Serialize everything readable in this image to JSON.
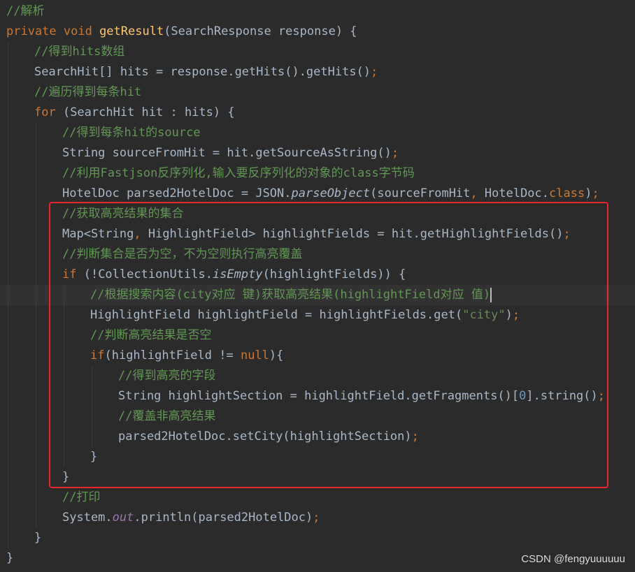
{
  "editor": {
    "lines": [
      {
        "indent": 0,
        "current": false,
        "tokens": [
          {
            "t": "//解析",
            "c": "cm"
          }
        ]
      },
      {
        "indent": 0,
        "current": false,
        "tokens": [
          {
            "t": "private void ",
            "c": "kw"
          },
          {
            "t": "getResult",
            "c": "fn"
          },
          {
            "t": "(SearchResponse response) {",
            "c": ""
          }
        ]
      },
      {
        "indent": 1,
        "current": false,
        "tokens": [
          {
            "t": "//得到hits数组",
            "c": "cm"
          }
        ]
      },
      {
        "indent": 1,
        "current": false,
        "tokens": [
          {
            "t": "SearchHit[] hits = response.getHits().getHits()",
            "c": ""
          },
          {
            "t": ";",
            "c": "kw"
          }
        ]
      },
      {
        "indent": 1,
        "current": false,
        "tokens": [
          {
            "t": "//遍历得到每条hit",
            "c": "cm"
          }
        ]
      },
      {
        "indent": 1,
        "current": false,
        "tokens": [
          {
            "t": "for ",
            "c": "kw"
          },
          {
            "t": "(SearchHit hit : hits) {",
            "c": ""
          }
        ]
      },
      {
        "indent": 2,
        "current": false,
        "tokens": [
          {
            "t": "//得到每条hit的source",
            "c": "cm"
          }
        ]
      },
      {
        "indent": 2,
        "current": false,
        "tokens": [
          {
            "t": "String sourceFromHit = hit.getSourceAsString()",
            "c": ""
          },
          {
            "t": ";",
            "c": "kw"
          }
        ]
      },
      {
        "indent": 2,
        "current": false,
        "tokens": [
          {
            "t": "//利用Fastjson反序列化,输入要反序列化的对象的class字节码",
            "c": "cm"
          }
        ]
      },
      {
        "indent": 2,
        "current": false,
        "tokens": [
          {
            "t": "HotelDoc parsed2HotelDoc = JSON.",
            "c": ""
          },
          {
            "t": "parseObject",
            "c": "it"
          },
          {
            "t": "(sourceFromHit",
            "c": ""
          },
          {
            "t": ", ",
            "c": "kw"
          },
          {
            "t": "HotelDoc.",
            "c": ""
          },
          {
            "t": "class",
            "c": "kw"
          },
          {
            "t": ")",
            "c": ""
          },
          {
            "t": ";",
            "c": "kw"
          }
        ]
      },
      {
        "indent": 2,
        "current": false,
        "tokens": [
          {
            "t": "//获取高亮结果的集合",
            "c": "cm"
          }
        ]
      },
      {
        "indent": 2,
        "current": false,
        "tokens": [
          {
            "t": "Map<String",
            "c": ""
          },
          {
            "t": ", ",
            "c": "kw"
          },
          {
            "t": "HighlightField> highlightFields = hit.getHighlightFields()",
            "c": ""
          },
          {
            "t": ";",
            "c": "kw"
          }
        ]
      },
      {
        "indent": 2,
        "current": false,
        "tokens": [
          {
            "t": "//判断集合是否为空，不为空则执行高亮覆盖",
            "c": "cm"
          }
        ]
      },
      {
        "indent": 2,
        "current": false,
        "tokens": [
          {
            "t": "if ",
            "c": "kw"
          },
          {
            "t": "(!CollectionUtils.",
            "c": ""
          },
          {
            "t": "isEmpty",
            "c": "it"
          },
          {
            "t": "(highlightFields)) {",
            "c": ""
          }
        ]
      },
      {
        "indent": 3,
        "current": true,
        "caret": true,
        "tokens": [
          {
            "t": "//根据搜索内容(city对应 键)获取高亮结果(highlightField对应 值)",
            "c": "cm"
          }
        ]
      },
      {
        "indent": 3,
        "current": false,
        "tokens": [
          {
            "t": "HighlightField highlightField = highlightFields.get(",
            "c": ""
          },
          {
            "t": "\"city\"",
            "c": "st"
          },
          {
            "t": ")",
            "c": ""
          },
          {
            "t": ";",
            "c": "kw"
          }
        ]
      },
      {
        "indent": 3,
        "current": false,
        "tokens": [
          {
            "t": "//判断高亮结果是否空",
            "c": "cm"
          }
        ]
      },
      {
        "indent": 3,
        "current": false,
        "tokens": [
          {
            "t": "if",
            "c": "kw"
          },
          {
            "t": "(highlightField != ",
            "c": ""
          },
          {
            "t": "null",
            "c": "kw"
          },
          {
            "t": "){",
            "c": ""
          }
        ]
      },
      {
        "indent": 4,
        "current": false,
        "tokens": [
          {
            "t": "//得到高亮的字段",
            "c": "cm"
          }
        ]
      },
      {
        "indent": 4,
        "current": false,
        "tokens": [
          {
            "t": "String highlightSection = highlightField.getFragments()[",
            "c": ""
          },
          {
            "t": "0",
            "c": "nu"
          },
          {
            "t": "].string()",
            "c": ""
          },
          {
            "t": ";",
            "c": "kw"
          }
        ]
      },
      {
        "indent": 4,
        "current": false,
        "tokens": [
          {
            "t": "//覆盖非高亮结果",
            "c": "cm"
          }
        ]
      },
      {
        "indent": 4,
        "current": false,
        "tokens": [
          {
            "t": "parsed2HotelDoc.setCity(highlightSection)",
            "c": ""
          },
          {
            "t": ";",
            "c": "kw"
          }
        ]
      },
      {
        "indent": 3,
        "current": false,
        "tokens": [
          {
            "t": "}",
            "c": ""
          }
        ]
      },
      {
        "indent": 2,
        "current": false,
        "tokens": [
          {
            "t": "}",
            "c": ""
          }
        ]
      },
      {
        "indent": 2,
        "current": false,
        "tokens": [
          {
            "t": "//打印",
            "c": "cm"
          }
        ]
      },
      {
        "indent": 2,
        "current": false,
        "tokens": [
          {
            "t": "System.",
            "c": ""
          },
          {
            "t": "out",
            "c": "fd"
          },
          {
            "t": ".println(parsed2HotelDoc)",
            "c": ""
          },
          {
            "t": ";",
            "c": "kw"
          }
        ]
      },
      {
        "indent": 1,
        "current": false,
        "tokens": [
          {
            "t": "}",
            "c": ""
          }
        ]
      },
      {
        "indent": 0,
        "current": false,
        "tokens": [
          {
            "t": "}",
            "c": ""
          }
        ]
      }
    ]
  },
  "annotation": {
    "box_color": "#e8262b"
  },
  "watermark": "CSDN @fengyuuuuuu",
  "colors": {
    "background": "#2b2b2b",
    "default_text": "#a9b7c6",
    "keyword": "#cc7832",
    "method_declaration": "#ffc66d",
    "comment": "#629755",
    "string": "#6a8759",
    "number": "#6897bb",
    "static_field": "#9876aa",
    "current_line": "#323232"
  }
}
